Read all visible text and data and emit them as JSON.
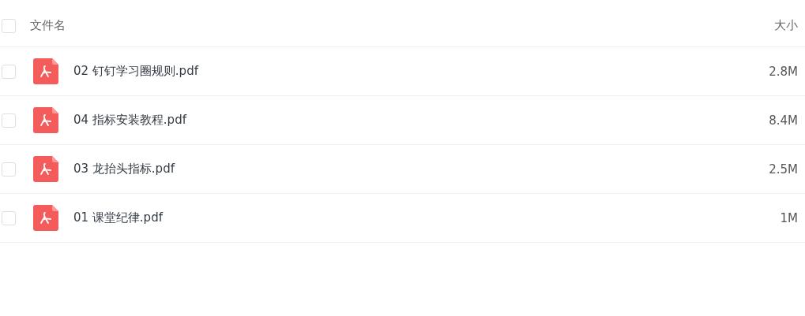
{
  "header": {
    "checked": false,
    "name_label": "文件名",
    "size_label": "大小"
  },
  "files": [
    {
      "checked": false,
      "name": "02 钉钉学习圈规则.pdf",
      "size": "2.8M"
    },
    {
      "checked": false,
      "name": "04 指标安装教程.pdf",
      "size": "8.4M"
    },
    {
      "checked": false,
      "name": "03 龙抬头指标.pdf",
      "size": "2.5M"
    },
    {
      "checked": false,
      "name": "01 课堂纪律.pdf",
      "size": "1M"
    }
  ]
}
